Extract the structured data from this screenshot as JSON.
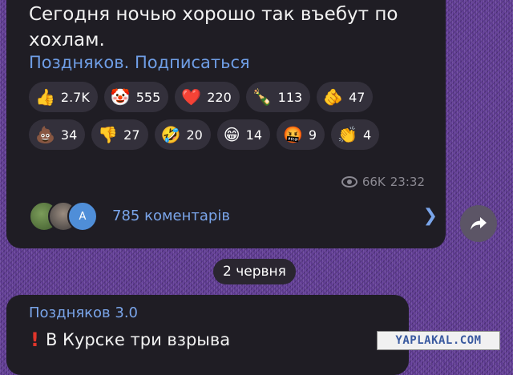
{
  "post1": {
    "text_line1": "Сегодня ночью хорошо так въебут по",
    "text_line2": "хохлам.",
    "signature": "Поздняков. Подписаться",
    "reactions_row1": [
      {
        "emoji": "👍",
        "icon": "thumbs-up-icon",
        "count": "2.7K"
      },
      {
        "emoji": "🤡",
        "icon": "clown-icon",
        "count": "555"
      },
      {
        "emoji": "❤️",
        "icon": "heart-icon",
        "count": "220"
      },
      {
        "emoji": "🍾",
        "icon": "champagne-icon",
        "count": "113"
      },
      {
        "emoji": "🫵",
        "icon": "pointing-hand-icon",
        "count": "47"
      }
    ],
    "reactions_row2": [
      {
        "emoji": "💩",
        "icon": "poop-icon",
        "count": "34"
      },
      {
        "emoji": "👎",
        "icon": "thumbs-down-icon",
        "count": "27"
      },
      {
        "emoji": "🤣",
        "icon": "rofl-icon",
        "count": "20"
      },
      {
        "emoji": "😁",
        "icon": "grin-icon",
        "count": "14"
      },
      {
        "emoji": "🤬",
        "icon": "cursing-face-icon",
        "count": "9"
      },
      {
        "emoji": "👏",
        "icon": "clapping-icon",
        "count": "4"
      }
    ],
    "views": "66K",
    "time": "23:32",
    "comments_label": "785 коментарів",
    "avatar_letter": "A"
  },
  "date_separator": "2 червня",
  "post2": {
    "author": "Поздняков 3.0",
    "text": "В Курске три взрыва"
  },
  "watermark": "YAPLAKAL.COM"
}
